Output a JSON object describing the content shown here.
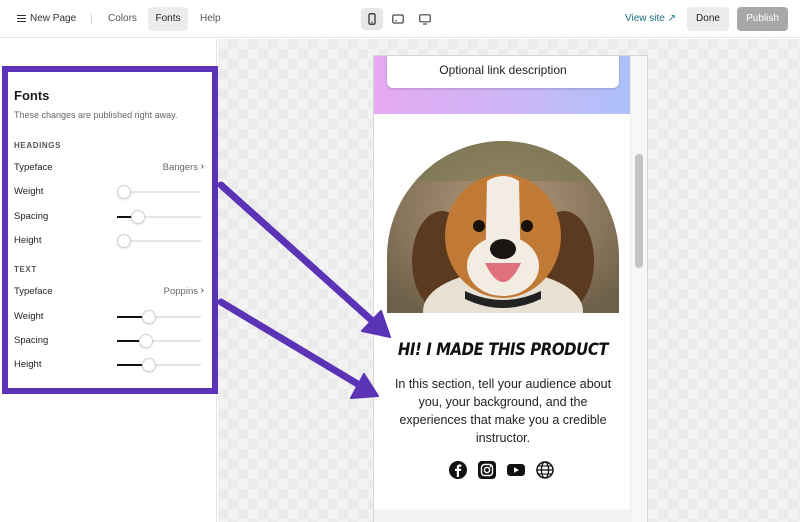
{
  "topbar": {
    "new_page": "New Page",
    "tabs": [
      {
        "label": "Colors"
      },
      {
        "label": "Fonts"
      },
      {
        "label": "Help"
      }
    ],
    "view_site": "View site ↗",
    "done": "Done",
    "publish": "Publish"
  },
  "fonts_panel": {
    "title": "Fonts",
    "subtitle": "These changes are published right away.",
    "headings": {
      "section": "HEADINGS",
      "typeface_label": "Typeface",
      "typeface_value": "Bangers",
      "weight_label": "Weight",
      "weight": 0.0,
      "spacing_label": "Spacing",
      "spacing": 0.2,
      "height_label": "Height",
      "height": 0.0
    },
    "text": {
      "section": "TEXT",
      "typeface_label": "Typeface",
      "typeface_value": "Poppins",
      "weight_label": "Weight",
      "weight": 0.35,
      "spacing_label": "Spacing",
      "spacing": 0.32,
      "height_label": "Height",
      "height": 0.36
    }
  },
  "preview": {
    "link_description": "Optional link description",
    "headline": "HI! I MADE THIS PRODUCT",
    "bio": "In this section, tell your audience about you, your background, and the experiences that make you a credible instructor.",
    "socials": [
      "facebook-icon",
      "instagram-icon",
      "youtube-icon",
      "globe-icon"
    ]
  },
  "colors": {
    "accent": "#5b33b6",
    "link": "#1a6f86",
    "gradient_start": "#e6a9f2",
    "gradient_end": "#a8c4fb"
  }
}
